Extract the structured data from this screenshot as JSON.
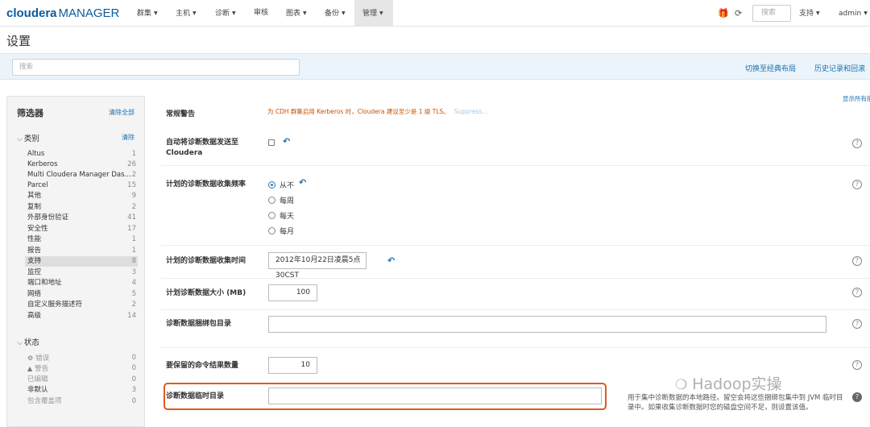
{
  "brand": {
    "name": "cloudera",
    "suffix": "MANAGER"
  },
  "nav": {
    "items": [
      {
        "label": "群集",
        "caret": true
      },
      {
        "label": "主机",
        "caret": true
      },
      {
        "label": "诊断",
        "caret": true
      },
      {
        "label": "审核",
        "caret": false
      },
      {
        "label": "图表",
        "caret": true
      },
      {
        "label": "备份",
        "caret": true
      },
      {
        "label": "管理",
        "caret": true,
        "active": true
      }
    ],
    "search_placeholder": "搜索",
    "support": "支持",
    "user": "admin"
  },
  "page": {
    "title": "设置"
  },
  "searchbar": {
    "placeholder": "搜索",
    "switch_layout": "切换至经典布局",
    "history": "历史记录和回滚",
    "show_all": "显示所有描述"
  },
  "sidebar": {
    "title": "筛选器",
    "clear_all": "清除全部",
    "category": {
      "title": "类别",
      "clear": "清除",
      "items": [
        {
          "label": "Altus",
          "count": "1"
        },
        {
          "label": "Kerberos",
          "count": "26"
        },
        {
          "label": "Multi Cloudera Manager Das...",
          "count": "2"
        },
        {
          "label": "Parcel",
          "count": "15"
        },
        {
          "label": "其他",
          "count": "9"
        },
        {
          "label": "复制",
          "count": "2"
        },
        {
          "label": "外部身份验证",
          "count": "41"
        },
        {
          "label": "安全性",
          "count": "17"
        },
        {
          "label": "性能",
          "count": "1"
        },
        {
          "label": "报告",
          "count": "1"
        },
        {
          "label": "支持",
          "count": "8",
          "selected": true
        },
        {
          "label": "监控",
          "count": "3"
        },
        {
          "label": "端口和地址",
          "count": "4"
        },
        {
          "label": "网络",
          "count": "5"
        },
        {
          "label": "自定义服务描述符",
          "count": "2"
        },
        {
          "label": "高级",
          "count": "14"
        }
      ]
    },
    "status": {
      "title": "状态",
      "items": [
        {
          "label": "错误",
          "count": "0",
          "icon": "error-icon",
          "glyph": "⚙"
        },
        {
          "label": "警告",
          "count": "0",
          "icon": "warning-icon",
          "glyph": "▲"
        },
        {
          "label": "已编辑",
          "count": "0"
        },
        {
          "label": "非默认",
          "count": "3"
        },
        {
          "label": "包含覆盖项",
          "count": "0"
        }
      ]
    }
  },
  "settings": {
    "general_warning_label": "常规警告",
    "general_warning_msg": "为 CDH 群集启用 Kerberos 时，Cloudera 建议至少是 1 级 TLS。",
    "suppress": "Suppress...",
    "auto_send_label_1": "自动将诊断数据发送至",
    "auto_send_label_2": "Cloudera",
    "freq_label": "计划的诊断数据收集频率",
    "freq_options": [
      "从不",
      "每周",
      "每天",
      "每月"
    ],
    "freq_selected": "从不",
    "time_label": "计划的诊断数据收集时间",
    "time_value": "2012年10月22日凌晨5点30CST",
    "size_label": "计划诊断数据大小 (MB)",
    "size_value": "100",
    "bundle_dir_label": "诊断数据捆绑包目录",
    "bundle_dir_value": "",
    "cmd_results_label": "要保留的命令结果数量",
    "cmd_results_value": "10",
    "temp_dir_label": "诊断数据临时目录",
    "temp_dir_value": "",
    "temp_dir_desc": "用于集中诊断数据的本地路径。留空会将这些捆绑包集中到 JVM 临时目录中。如果收集诊断数据时您的磁盘空间不足，则设置该值。"
  },
  "watermark": "Hadoop实操",
  "colors": {
    "brand": "#0a5ba0",
    "link": "#1a6fb0",
    "warning": "#c75000",
    "highlight": "#e05a1c"
  }
}
